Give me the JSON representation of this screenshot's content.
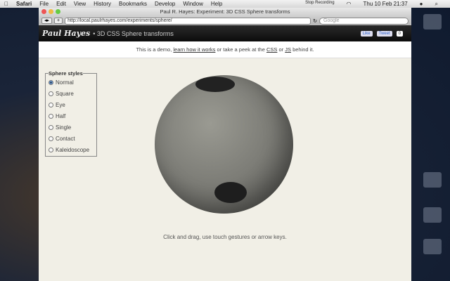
{
  "menubar": {
    "app": "Safari",
    "items": [
      "File",
      "Edit",
      "View",
      "History",
      "Bookmarks",
      "Develop",
      "Window",
      "Help"
    ],
    "recording": "Stop Recording",
    "clock": "Thu 10 Feb  21:37"
  },
  "window": {
    "title": "Paul R. Hayes: Experiment: 3D CSS Sphere transforms",
    "url": "http://local.paulrhayes.com/experiments/sphere/",
    "search_placeholder": "Google"
  },
  "header": {
    "logo": "Paul Hayes",
    "title": "• 3D CSS Sphere transforms",
    "like": "Like",
    "tweet": "Tweet",
    "count": "0"
  },
  "subbar": {
    "t1": "This is a demo, ",
    "link1": "learn how it works",
    "t2": " or take a peek at the ",
    "link2": "CSS",
    "t3": " or ",
    "link3": "JS",
    "t4": " behind it."
  },
  "styles": {
    "legend": "Sphere styles",
    "options": [
      "Normal",
      "Square",
      "Eye",
      "Half",
      "Single",
      "Contact",
      "Kaleidoscope"
    ],
    "selected": "Normal"
  },
  "hint": "Click and drag, use touch gestures or arrow keys."
}
